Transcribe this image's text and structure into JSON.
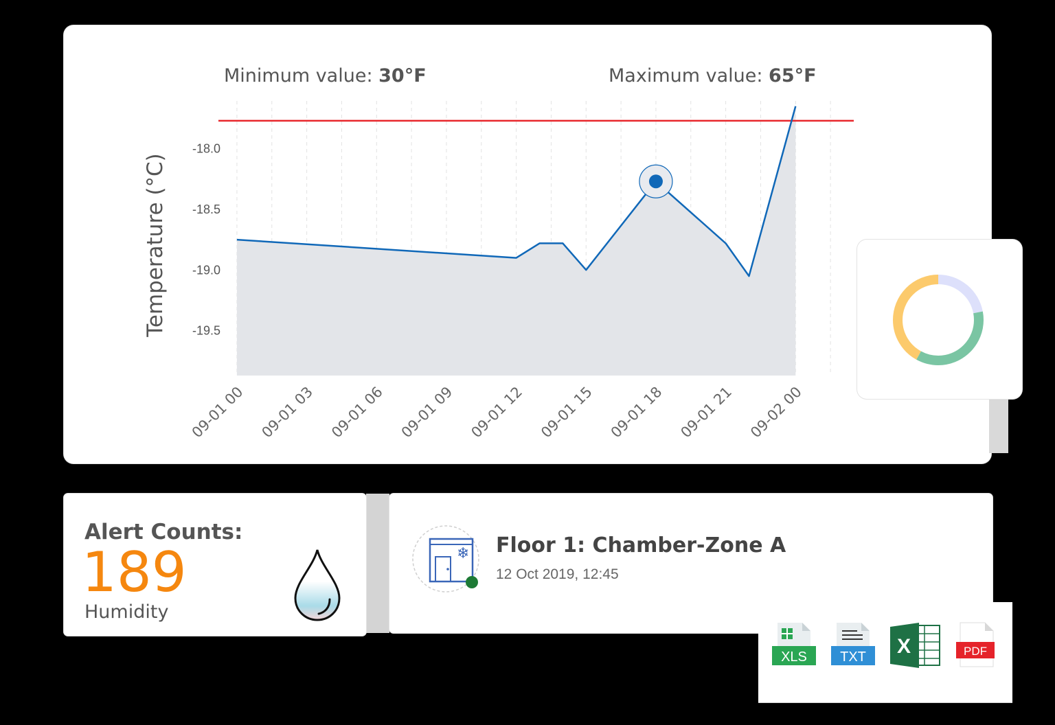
{
  "header": {
    "min_label": "Minimum value: ",
    "min_value": "30°F",
    "max_label": "Maximum value: ",
    "max_value": "65°F"
  },
  "chart_data": {
    "type": "area",
    "ylabel": "Temperature (°C)",
    "xlabel": "",
    "x_ticks": [
      "09-01 00",
      "09-01 03",
      "09-01 06",
      "09-01 09",
      "09-01 12",
      "09-01 15",
      "09-01 18",
      "09-01 21",
      "09-02 00"
    ],
    "y_ticks": [
      -18.0,
      -18.5,
      -19.0,
      -19.5
    ],
    "y_tick_labels": [
      "-18.0",
      "-18.5",
      "-19.0",
      "-19.5"
    ],
    "ylim": [
      -19.87,
      -17.55
    ],
    "xlim_hours": [
      -0.5,
      26.5
    ],
    "threshold": -17.77,
    "threshold_color": "#e8262b",
    "line_color": "#1068b8",
    "fill_color": "#e3e5e9",
    "grid": true,
    "highlight_point": {
      "x": "09-01 18",
      "y": -18.27
    },
    "series": [
      {
        "x": [
          "09-01 00",
          "09-01 12",
          "09-01 13",
          "09-01 14",
          "09-01 15",
          "09-01 18",
          "09-01 21",
          "09-01 22",
          "09-02 00"
        ],
        "values": [
          -18.75,
          -18.9,
          -18.78,
          -18.78,
          -19.0,
          -18.27,
          -18.78,
          -19.05,
          -17.65
        ]
      }
    ]
  },
  "donut": {
    "colors": {
      "yellow": "#fcca6c",
      "green": "#7ac5a3",
      "lavender": "#dde0fb"
    },
    "segments": [
      {
        "name": "yellow",
        "value": 0.42
      },
      {
        "name": "green",
        "value": 0.36
      },
      {
        "name": "lavender",
        "value": 0.22
      }
    ]
  },
  "alert": {
    "title": "Alert Counts:",
    "count": "189",
    "subtitle": "Humidity"
  },
  "zone": {
    "title": "Floor 1: Chamber-Zone A",
    "timestamp": "12 Oct 2019, 12:45",
    "status_color": "#1d7a35"
  },
  "export": {
    "xls_label": "XLS",
    "txt_label": "TXT",
    "excel_label": "X",
    "pdf_label": "PDF"
  }
}
